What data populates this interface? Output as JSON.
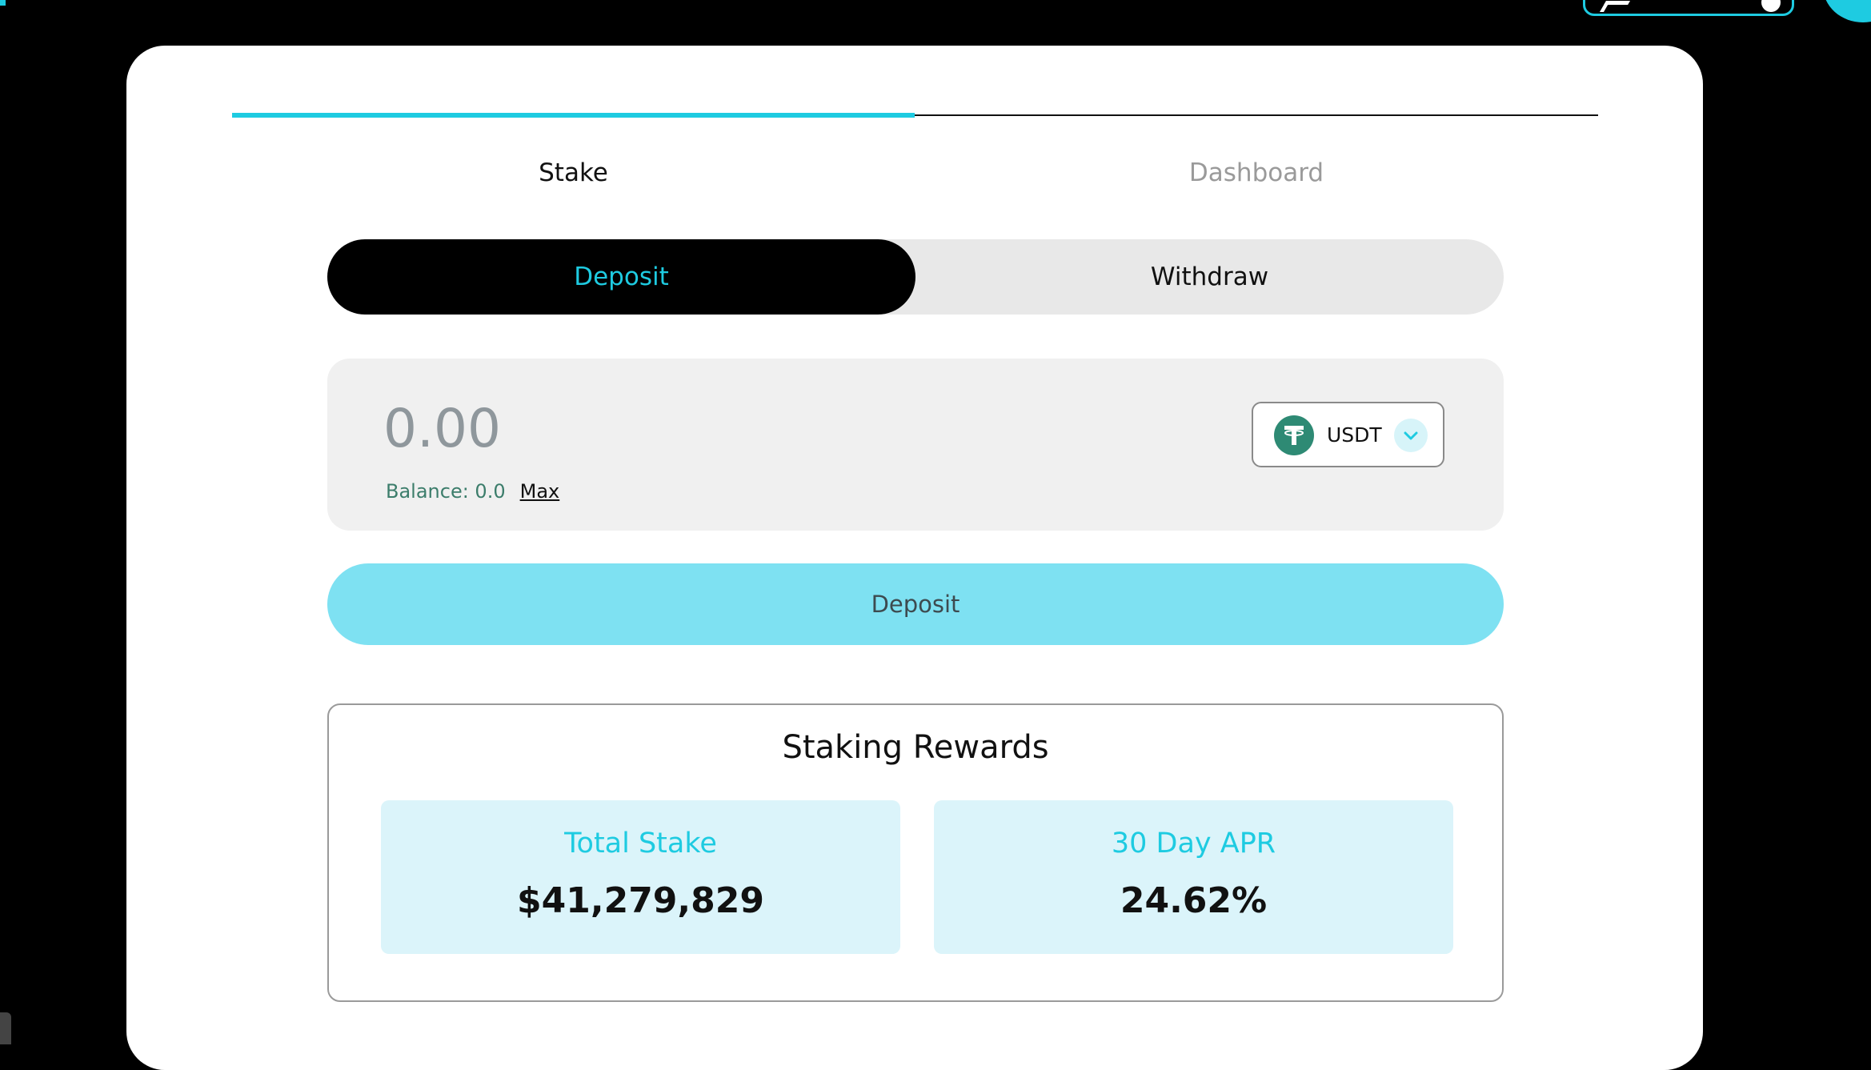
{
  "tabs": [
    {
      "label": "Stake",
      "active": true
    },
    {
      "label": "Dashboard",
      "active": false
    }
  ],
  "mode_toggle": {
    "deposit_label": "Deposit",
    "withdraw_label": "Withdraw",
    "selected": "Deposit"
  },
  "amount": {
    "placeholder": "0.00",
    "value": "",
    "balance_label": "Balance: 0.0",
    "max_label": "Max"
  },
  "token": {
    "symbol": "USDT",
    "icon": "tether-icon",
    "chevron": "chevron-down-icon"
  },
  "action": {
    "deposit_button_label": "Deposit"
  },
  "rewards": {
    "title": "Staking Rewards",
    "total_stake_label": "Total Stake",
    "total_stake_value": "$41,279,829",
    "apr_label": "30 Day APR",
    "apr_value": "24.62%"
  },
  "colors": {
    "accent": "#1ecbe1",
    "button_fill": "#7ee1f2",
    "stat_fill": "#dbf4fa",
    "tether_green": "#2e8a74",
    "balance_green": "#3c7d6b"
  }
}
